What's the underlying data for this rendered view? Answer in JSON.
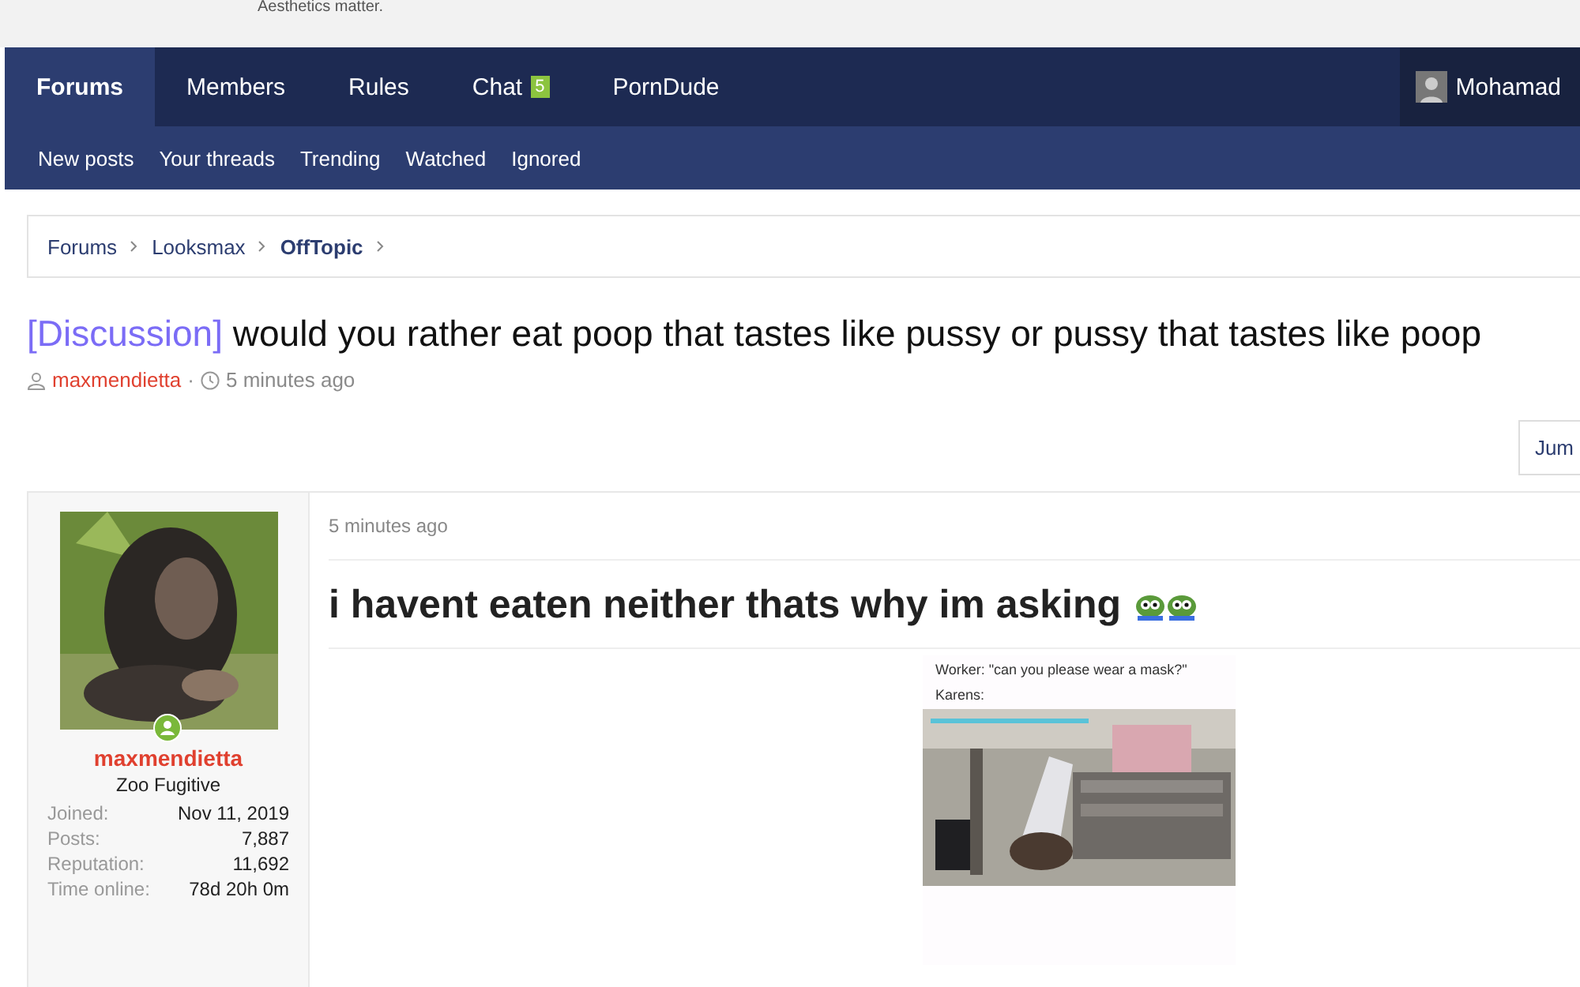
{
  "site_tagline": "Aesthetics matter.",
  "nav": {
    "tabs": [
      {
        "label": "Forums",
        "selected": true
      },
      {
        "label": "Members",
        "selected": false
      },
      {
        "label": "Rules",
        "selected": false
      },
      {
        "label": "Chat",
        "badge": "5",
        "selected": false
      },
      {
        "label": "PornDude",
        "selected": false
      }
    ],
    "user": "Mohamad"
  },
  "subnav": [
    "New posts",
    "Your threads",
    "Trending",
    "Watched",
    "Ignored"
  ],
  "breadcrumbs": [
    {
      "label": "Forums",
      "current": false
    },
    {
      "label": "Looksmax",
      "current": false
    },
    {
      "label": "OffTopic",
      "current": true
    }
  ],
  "thread": {
    "prefix": "[Discussion]",
    "title": "would you rather eat poop that tastes like pussy or pussy that tastes like poop",
    "author": "maxmendietta",
    "separator": "·",
    "time": "5 minutes ago"
  },
  "jump_button": "Jum",
  "post": {
    "user": {
      "name": "maxmendietta",
      "title": "Zoo Fugitive",
      "online": true,
      "stats": [
        {
          "label": "Joined:",
          "value": "Nov 11, 2019"
        },
        {
          "label": "Posts:",
          "value": "7,887"
        },
        {
          "label": "Reputation:",
          "value": "11,692"
        },
        {
          "label": "Time online:",
          "value": "78d 20h 0m"
        }
      ]
    },
    "time": "5 minutes ago",
    "headline": "i havent eaten neither thats why im asking",
    "emojis": [
      {
        "kind": "frog"
      },
      {
        "kind": "frog"
      }
    ],
    "image": {
      "caption_lines": [
        "Worker: \"can you please wear a mask?\"",
        "Karens:"
      ]
    }
  }
}
